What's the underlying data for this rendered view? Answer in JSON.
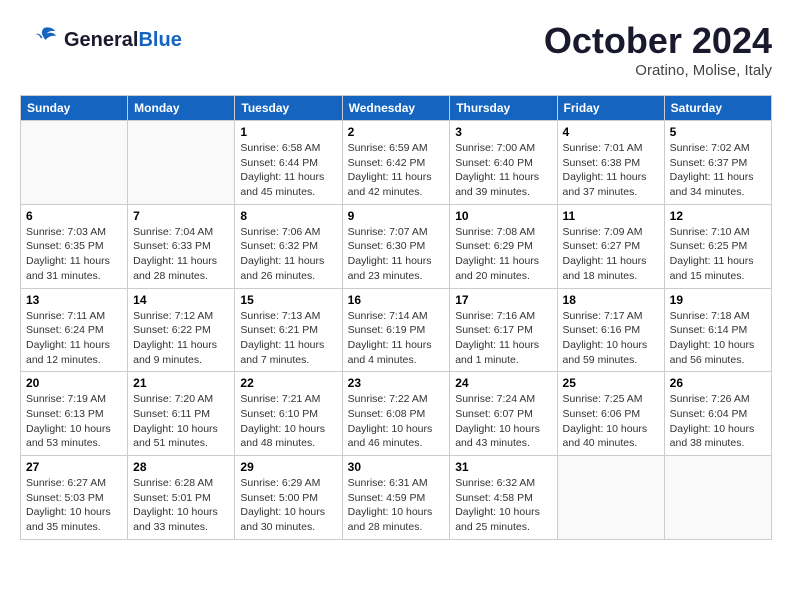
{
  "header": {
    "logo_general": "General",
    "logo_blue": "Blue",
    "month_year": "October 2024",
    "location": "Oratino, Molise, Italy"
  },
  "days_of_week": [
    "Sunday",
    "Monday",
    "Tuesday",
    "Wednesday",
    "Thursday",
    "Friday",
    "Saturday"
  ],
  "weeks": [
    [
      {
        "day": "",
        "sunrise": "",
        "sunset": "",
        "daylight": ""
      },
      {
        "day": "",
        "sunrise": "",
        "sunset": "",
        "daylight": ""
      },
      {
        "day": "1",
        "sunrise": "Sunrise: 6:58 AM",
        "sunset": "Sunset: 6:44 PM",
        "daylight": "Daylight: 11 hours and 45 minutes."
      },
      {
        "day": "2",
        "sunrise": "Sunrise: 6:59 AM",
        "sunset": "Sunset: 6:42 PM",
        "daylight": "Daylight: 11 hours and 42 minutes."
      },
      {
        "day": "3",
        "sunrise": "Sunrise: 7:00 AM",
        "sunset": "Sunset: 6:40 PM",
        "daylight": "Daylight: 11 hours and 39 minutes."
      },
      {
        "day": "4",
        "sunrise": "Sunrise: 7:01 AM",
        "sunset": "Sunset: 6:38 PM",
        "daylight": "Daylight: 11 hours and 37 minutes."
      },
      {
        "day": "5",
        "sunrise": "Sunrise: 7:02 AM",
        "sunset": "Sunset: 6:37 PM",
        "daylight": "Daylight: 11 hours and 34 minutes."
      }
    ],
    [
      {
        "day": "6",
        "sunrise": "Sunrise: 7:03 AM",
        "sunset": "Sunset: 6:35 PM",
        "daylight": "Daylight: 11 hours and 31 minutes."
      },
      {
        "day": "7",
        "sunrise": "Sunrise: 7:04 AM",
        "sunset": "Sunset: 6:33 PM",
        "daylight": "Daylight: 11 hours and 28 minutes."
      },
      {
        "day": "8",
        "sunrise": "Sunrise: 7:06 AM",
        "sunset": "Sunset: 6:32 PM",
        "daylight": "Daylight: 11 hours and 26 minutes."
      },
      {
        "day": "9",
        "sunrise": "Sunrise: 7:07 AM",
        "sunset": "Sunset: 6:30 PM",
        "daylight": "Daylight: 11 hours and 23 minutes."
      },
      {
        "day": "10",
        "sunrise": "Sunrise: 7:08 AM",
        "sunset": "Sunset: 6:29 PM",
        "daylight": "Daylight: 11 hours and 20 minutes."
      },
      {
        "day": "11",
        "sunrise": "Sunrise: 7:09 AM",
        "sunset": "Sunset: 6:27 PM",
        "daylight": "Daylight: 11 hours and 18 minutes."
      },
      {
        "day": "12",
        "sunrise": "Sunrise: 7:10 AM",
        "sunset": "Sunset: 6:25 PM",
        "daylight": "Daylight: 11 hours and 15 minutes."
      }
    ],
    [
      {
        "day": "13",
        "sunrise": "Sunrise: 7:11 AM",
        "sunset": "Sunset: 6:24 PM",
        "daylight": "Daylight: 11 hours and 12 minutes."
      },
      {
        "day": "14",
        "sunrise": "Sunrise: 7:12 AM",
        "sunset": "Sunset: 6:22 PM",
        "daylight": "Daylight: 11 hours and 9 minutes."
      },
      {
        "day": "15",
        "sunrise": "Sunrise: 7:13 AM",
        "sunset": "Sunset: 6:21 PM",
        "daylight": "Daylight: 11 hours and 7 minutes."
      },
      {
        "day": "16",
        "sunrise": "Sunrise: 7:14 AM",
        "sunset": "Sunset: 6:19 PM",
        "daylight": "Daylight: 11 hours and 4 minutes."
      },
      {
        "day": "17",
        "sunrise": "Sunrise: 7:16 AM",
        "sunset": "Sunset: 6:17 PM",
        "daylight": "Daylight: 11 hours and 1 minute."
      },
      {
        "day": "18",
        "sunrise": "Sunrise: 7:17 AM",
        "sunset": "Sunset: 6:16 PM",
        "daylight": "Daylight: 10 hours and 59 minutes."
      },
      {
        "day": "19",
        "sunrise": "Sunrise: 7:18 AM",
        "sunset": "Sunset: 6:14 PM",
        "daylight": "Daylight: 10 hours and 56 minutes."
      }
    ],
    [
      {
        "day": "20",
        "sunrise": "Sunrise: 7:19 AM",
        "sunset": "Sunset: 6:13 PM",
        "daylight": "Daylight: 10 hours and 53 minutes."
      },
      {
        "day": "21",
        "sunrise": "Sunrise: 7:20 AM",
        "sunset": "Sunset: 6:11 PM",
        "daylight": "Daylight: 10 hours and 51 minutes."
      },
      {
        "day": "22",
        "sunrise": "Sunrise: 7:21 AM",
        "sunset": "Sunset: 6:10 PM",
        "daylight": "Daylight: 10 hours and 48 minutes."
      },
      {
        "day": "23",
        "sunrise": "Sunrise: 7:22 AM",
        "sunset": "Sunset: 6:08 PM",
        "daylight": "Daylight: 10 hours and 46 minutes."
      },
      {
        "day": "24",
        "sunrise": "Sunrise: 7:24 AM",
        "sunset": "Sunset: 6:07 PM",
        "daylight": "Daylight: 10 hours and 43 minutes."
      },
      {
        "day": "25",
        "sunrise": "Sunrise: 7:25 AM",
        "sunset": "Sunset: 6:06 PM",
        "daylight": "Daylight: 10 hours and 40 minutes."
      },
      {
        "day": "26",
        "sunrise": "Sunrise: 7:26 AM",
        "sunset": "Sunset: 6:04 PM",
        "daylight": "Daylight: 10 hours and 38 minutes."
      }
    ],
    [
      {
        "day": "27",
        "sunrise": "Sunrise: 6:27 AM",
        "sunset": "Sunset: 5:03 PM",
        "daylight": "Daylight: 10 hours and 35 minutes."
      },
      {
        "day": "28",
        "sunrise": "Sunrise: 6:28 AM",
        "sunset": "Sunset: 5:01 PM",
        "daylight": "Daylight: 10 hours and 33 minutes."
      },
      {
        "day": "29",
        "sunrise": "Sunrise: 6:29 AM",
        "sunset": "Sunset: 5:00 PM",
        "daylight": "Daylight: 10 hours and 30 minutes."
      },
      {
        "day": "30",
        "sunrise": "Sunrise: 6:31 AM",
        "sunset": "Sunset: 4:59 PM",
        "daylight": "Daylight: 10 hours and 28 minutes."
      },
      {
        "day": "31",
        "sunrise": "Sunrise: 6:32 AM",
        "sunset": "Sunset: 4:58 PM",
        "daylight": "Daylight: 10 hours and 25 minutes."
      },
      {
        "day": "",
        "sunrise": "",
        "sunset": "",
        "daylight": ""
      },
      {
        "day": "",
        "sunrise": "",
        "sunset": "",
        "daylight": ""
      }
    ]
  ]
}
